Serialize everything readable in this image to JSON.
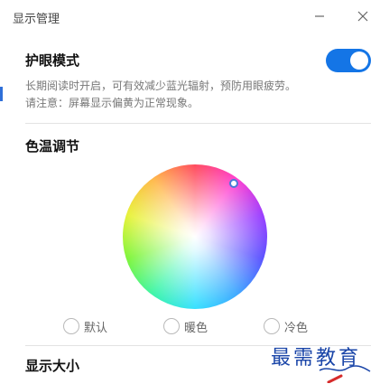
{
  "window": {
    "title": "显示管理"
  },
  "eye_care": {
    "title": "护眼模式",
    "enabled": true,
    "desc_line1": "长期阅读时开启，可有效减少蓝光辐射，预防用眼疲劳。",
    "desc_line2": "请注意：屏幕显示偏黄为正常现象。"
  },
  "color_temp": {
    "title": "色温调节",
    "options": [
      {
        "label": "默认",
        "selected": false
      },
      {
        "label": "暖色",
        "selected": false
      },
      {
        "label": "冷色",
        "selected": false
      }
    ]
  },
  "display_size": {
    "title": "显示大小"
  },
  "watermark": {
    "text": "最需教育"
  },
  "colors": {
    "toggle_on": "#1475e6",
    "watermark": "#1a45a8"
  }
}
